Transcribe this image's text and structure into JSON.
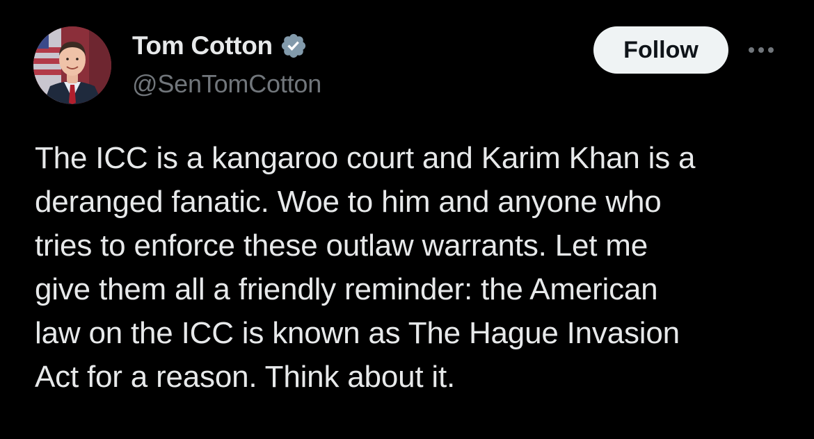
{
  "post": {
    "author": {
      "display_name": "Tom Cotton",
      "handle": "@SenTomCotton",
      "verified_icon": "verified-badge-icon",
      "avatar_icon": "avatar-photo"
    },
    "follow_label": "Follow",
    "more_icon": "more-options-icon",
    "text": "The ICC is a kangaroo court and Karim Khan is a\nderanged fanatic. Woe to him and anyone who\ntries to enforce these outlaw warrants. Let me\ngive them all a friendly reminder: the American\nlaw on the ICC is known as The Hague Invasion\nAct for a reason. Think about it."
  },
  "colors": {
    "background": "#000000",
    "primary_text": "#e7e9ea",
    "secondary_text": "#71767b",
    "follow_bg": "#eff3f4",
    "follow_text": "#0f1419",
    "verified_badge": "#829aab"
  }
}
